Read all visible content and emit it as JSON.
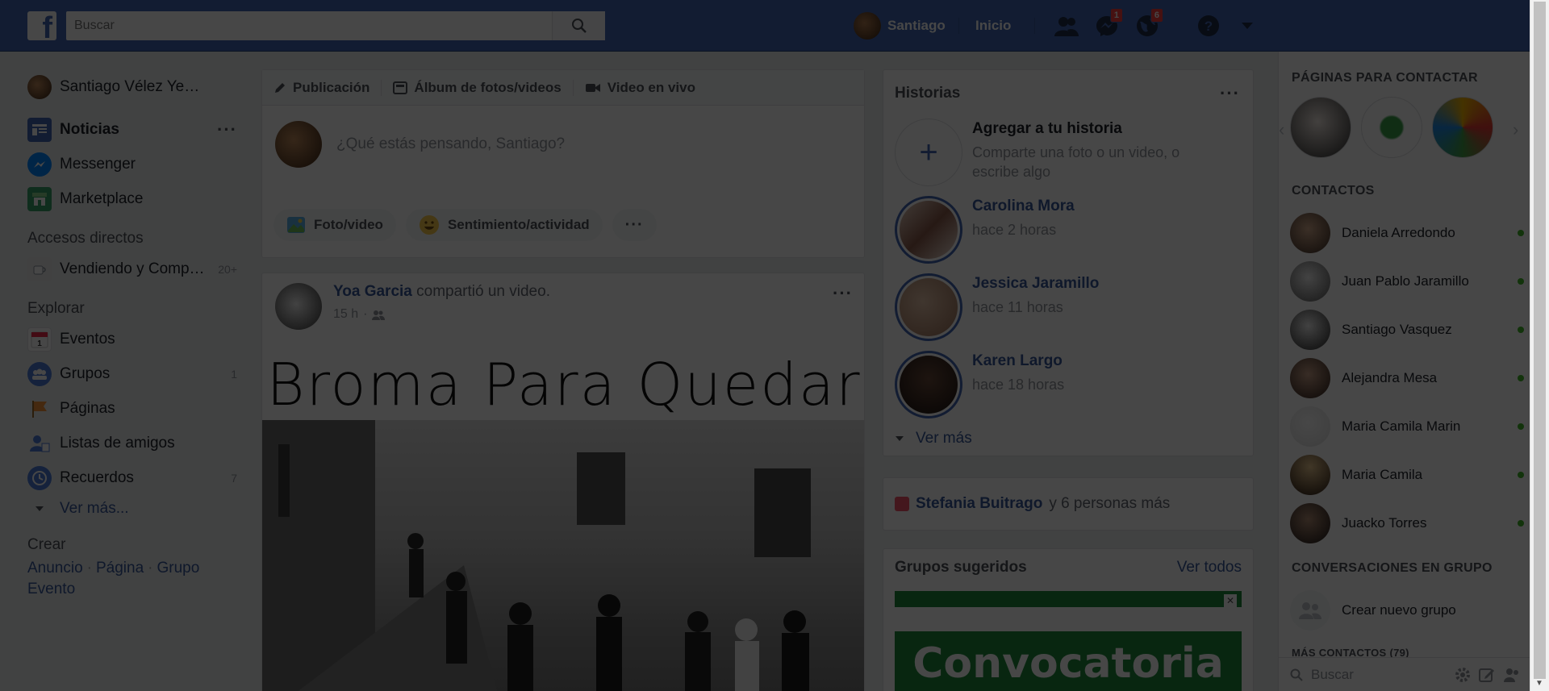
{
  "topbar": {
    "logo_letter": "f",
    "search_placeholder": "Buscar",
    "profile_name": "Santiago",
    "home_label": "Inicio",
    "friend_requests_badge": "",
    "messages_badge": "1",
    "notifications_badge": "6"
  },
  "leftnav": {
    "profile_name": "Santiago Vélez Ye…",
    "items": [
      {
        "label": "Noticias",
        "icon": "news-feed-icon"
      },
      {
        "label": "Messenger",
        "icon": "messenger-icon"
      },
      {
        "label": "Marketplace",
        "icon": "marketplace-icon"
      }
    ],
    "shortcuts_heading": "Accesos directos",
    "shortcut_label": "Vendiendo y Comp…",
    "shortcut_count": "20+",
    "explore_heading": "Explorar",
    "explore_items": [
      {
        "label": "Eventos",
        "count": ""
      },
      {
        "label": "Grupos",
        "count": "1"
      },
      {
        "label": "Páginas",
        "count": ""
      },
      {
        "label": "Listas de amigos",
        "count": ""
      },
      {
        "label": "Recuerdos",
        "count": "7"
      }
    ],
    "see_more": "Ver más...",
    "create_heading": "Crear",
    "create_links": [
      "Anuncio",
      "Página",
      "Grupo",
      "Evento"
    ]
  },
  "composer": {
    "tab_post": "Publicación",
    "tab_album": "Álbum de fotos/videos",
    "tab_live": "Video en vivo",
    "placeholder": "¿Qué estás pensando, Santiago?",
    "action_photo": "Foto/video",
    "action_feeling": "Sentimiento/actividad"
  },
  "post": {
    "author": "Yoa Garcia",
    "action": "compartió un video.",
    "time": "15 h",
    "image_title": "Broma Para Quedar"
  },
  "stories": {
    "heading": "Historias",
    "add_title": "Agregar a tu historia",
    "add_sub": "Comparte una foto o un video, o escribe algo",
    "items": [
      {
        "name": "Carolina Mora",
        "time": "hace 2 horas"
      },
      {
        "name": "Jessica Jaramillo",
        "time": "hace 11 horas"
      },
      {
        "name": "Karen Largo",
        "time": "hace 18 horas"
      }
    ],
    "see_more": "Ver más"
  },
  "birthday": {
    "name": "Stefania Buitrago",
    "rest": "y 6 personas más"
  },
  "groups": {
    "heading": "Grupos sugeridos",
    "see_all": "Ver todos",
    "banner_text": "Convocatoria"
  },
  "chat": {
    "pages_heading": "Páginas para contactar",
    "contacts_heading": "Contactos",
    "contacts": [
      {
        "name": "Daniela Arredondo"
      },
      {
        "name": "Juan Pablo Jaramillo"
      },
      {
        "name": "Santiago Vasquez"
      },
      {
        "name": "Alejandra Mesa"
      },
      {
        "name": "Maria Camila Marin"
      },
      {
        "name": "Maria Camila"
      },
      {
        "name": "Juacko Torres"
      }
    ],
    "group_conv_heading": "Conversaciones en grupo",
    "create_group": "Crear nuevo grupo",
    "more_contacts": "Más contactos (79)",
    "search_placeholder": "Buscar"
  },
  "colors": {
    "brand": "#4267b2",
    "link": "#365899",
    "online": "#42b72a",
    "badge": "#fa3e3e"
  }
}
